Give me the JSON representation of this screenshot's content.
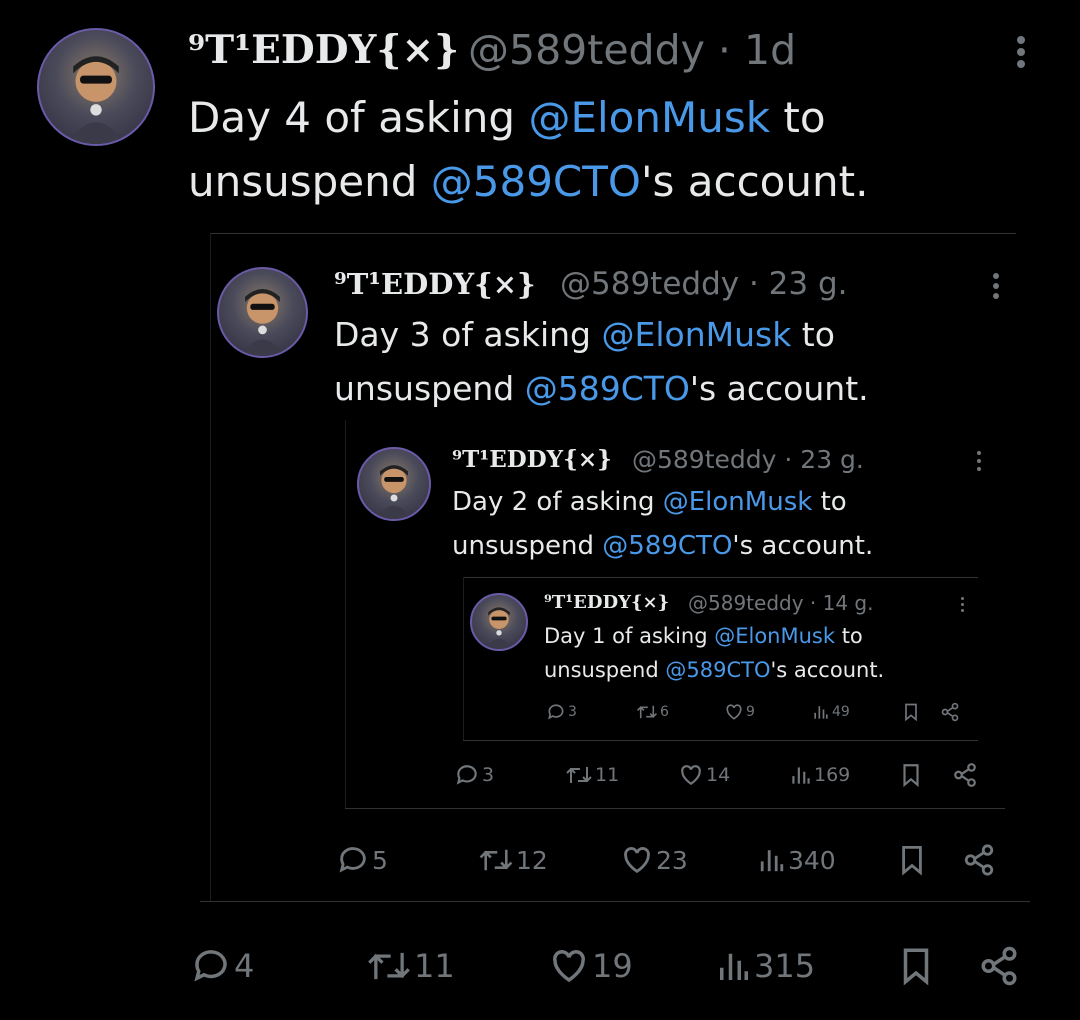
{
  "tweet4": {
    "name": "⁹T¹EDDY{×}",
    "handle": "@589teddy",
    "time": "· 1d",
    "text_a": "Day 4 of asking ",
    "mention_a": "@ElonMusk",
    "text_b": " to",
    "text_c": "unsuspend ",
    "mention_b": "@589CTO",
    "text_d": "'s account.",
    "replies": "4",
    "retweets": "11",
    "likes": "19",
    "views": "315"
  },
  "tweet3": {
    "name": "⁹T¹EDDY{×}",
    "handle": "@589teddy",
    "time": "· 23 g.",
    "text_a": "Day 3 of asking ",
    "mention_a": "@ElonMusk",
    "text_b": " to",
    "text_c": "unsuspend ",
    "mention_b": "@589CTO",
    "text_d": "'s account.",
    "replies": "5",
    "retweets": "12",
    "likes": "23",
    "views": "340"
  },
  "tweet2": {
    "name": "⁹T¹EDDY{×}",
    "handle": "@589teddy",
    "time": "· 23 g.",
    "text_a": "Day 2 of asking ",
    "mention_a": "@ElonMusk",
    "text_b": " to",
    "text_c": "unsuspend ",
    "mention_b": "@589CTO",
    "text_d": "'s account.",
    "replies": "3",
    "retweets": "11",
    "likes": "14",
    "views": "169"
  },
  "tweet1": {
    "name": "⁹T¹EDDY{×}",
    "handle": "@589teddy",
    "time": "· 14 g.",
    "text_a": "Day 1 of asking ",
    "mention_a": "@ElonMusk",
    "text_b": " to",
    "text_c": "unsuspend ",
    "mention_b": "@589CTO",
    "text_d": "'s account.",
    "replies": "3",
    "retweets": "6",
    "likes": "9",
    "views": "49"
  },
  "colors": {
    "mention": "#4a99e9",
    "muted": "#71767b",
    "text": "#e7e9ea",
    "background": "#000000"
  },
  "icons": [
    "reply-icon",
    "retweet-icon",
    "like-icon",
    "views-icon",
    "bookmark-icon",
    "share-icon",
    "more-icon"
  ]
}
